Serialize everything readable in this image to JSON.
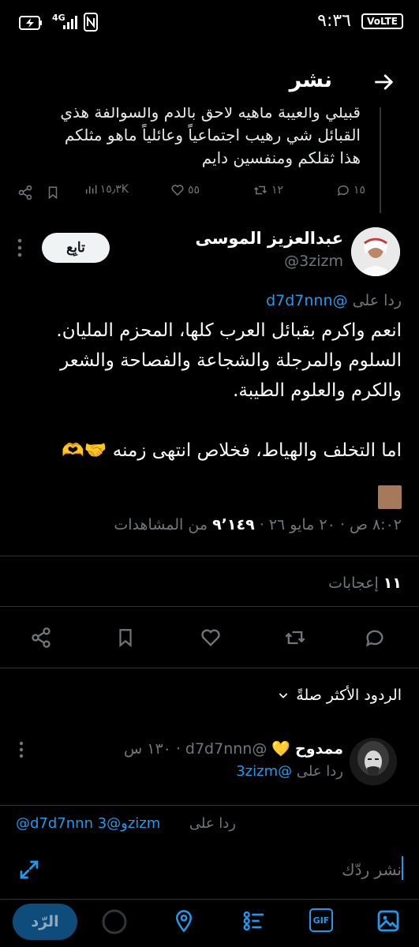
{
  "status_bar": {
    "time": "٩:٣٦",
    "network": "4G",
    "volte": "VoLTE"
  },
  "header": {
    "title": "نشر",
    "back_icon": "arrow-right-icon"
  },
  "parent_tweet": {
    "text_lines": [
      "قبيلي والعيبة ماهيه لاحق بالدم والسوالفة هذي",
      "القبائل شي رهيب اجتماعياً وعائلياً ماهو مثلكم",
      "هذا ثقلكم ومنفسين دايم"
    ],
    "replies": "١٥",
    "retweets": "١٢",
    "likes": "٥٥",
    "views": "١٥٫٣K"
  },
  "author": {
    "name": "عبدالعزيز الموسى",
    "handle": "@3zizm",
    "follow_label": "تابِع"
  },
  "tweet": {
    "reply_prefix": "ردا على",
    "reply_handle": "@d7d7nnn",
    "paragraph1": "انعم واكرم بقبائل العرب كلها، المحزم المليان.\nالسلوم والمرجلة والشجاعة والفصاحة والشعر\nوالكرم والعلوم الطيبة.",
    "paragraph2": "اما التخلف والهياط، فخلاص انتهى زمنه 🤝🫶",
    "time": "٨:٠٢ ص",
    "date": "٢٠ مايو ٢٦",
    "views_count": "٩٬١٤٩",
    "views_label": "من المشاهدات",
    "likes_count": "١١",
    "likes_label": "إعجابات"
  },
  "sort": {
    "label": "الردود الأكثر صلةً"
  },
  "reply_preview": {
    "name": "ممدوح",
    "emoji": "💛",
    "handle": "@d7d7nnn",
    "age": "١٣٠ س",
    "reply_prefix": "ردا على",
    "reply_handle": "@3zizm"
  },
  "composer": {
    "replying_prefix": "ردا على",
    "replying_handles": "@d7d7nnn و@3zizm",
    "placeholder": "نشر ردّك",
    "reply_button": "الرّد",
    "gif_label": "GIF"
  },
  "colors": {
    "background": "#000000",
    "text": "#e7e9ea",
    "muted": "#71767b",
    "link": "#1d9bf0"
  }
}
